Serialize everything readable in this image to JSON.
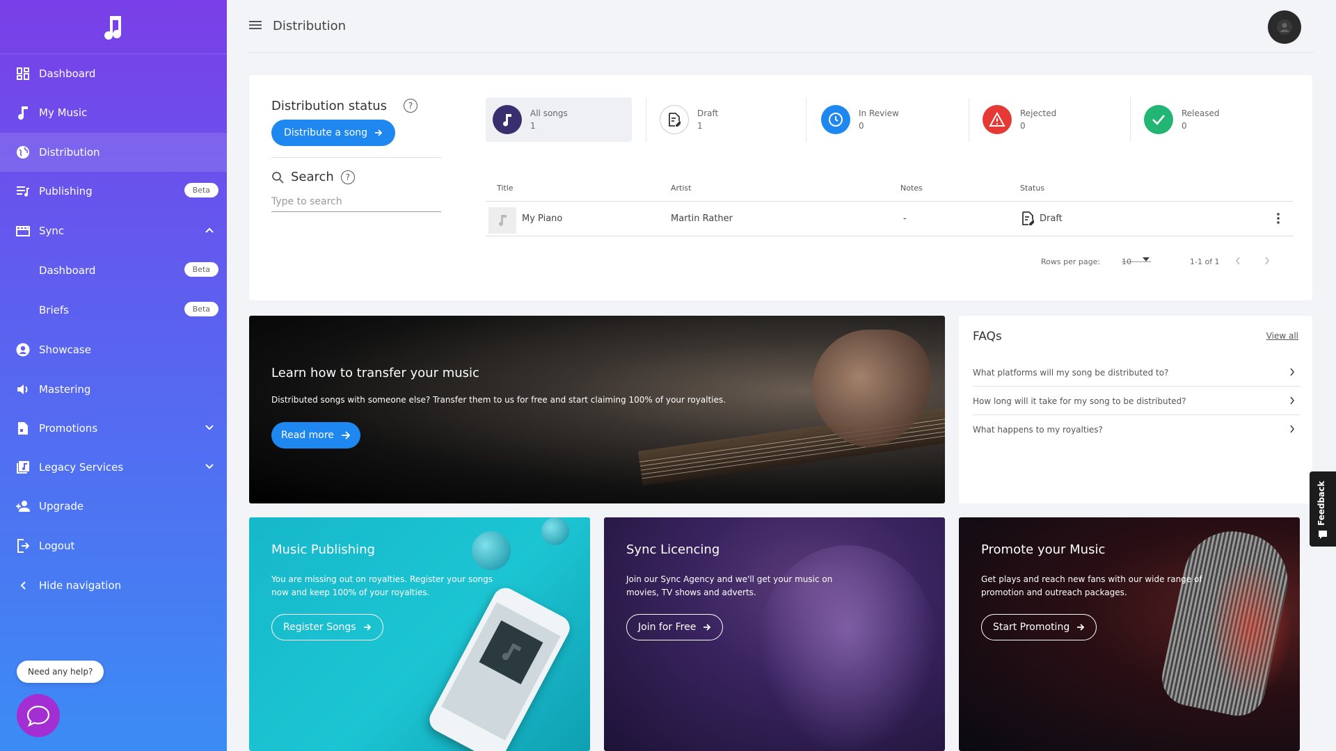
{
  "page": {
    "title": "Distribution"
  },
  "sidebar": {
    "items": [
      {
        "label": "Dashboard",
        "icon": "dashboard-icon"
      },
      {
        "label": "My Music",
        "icon": "music-note-icon"
      },
      {
        "label": "Distribution",
        "icon": "globe-icon",
        "active": true
      },
      {
        "label": "Publishing",
        "icon": "playlist-icon",
        "badge": "Beta"
      },
      {
        "label": "Sync",
        "icon": "clapperboard-icon",
        "expanded": true
      },
      {
        "label": "Dashboard",
        "sub": true,
        "badge": "Beta"
      },
      {
        "label": "Briefs",
        "sub": true,
        "badge": "Beta"
      },
      {
        "label": "Showcase",
        "icon": "account-circle-icon"
      },
      {
        "label": "Mastering",
        "icon": "speaker-icon"
      },
      {
        "label": "Promotions",
        "icon": "document-icon",
        "collapsed": true
      },
      {
        "label": "Legacy Services",
        "icon": "library-icon",
        "collapsed": true
      },
      {
        "label": "Upgrade",
        "icon": "user-plus-icon"
      },
      {
        "label": "Logout",
        "icon": "logout-icon"
      },
      {
        "label": "Hide navigation",
        "icon": "chevron-left-icon"
      }
    ],
    "help_label": "Need any help?"
  },
  "status": {
    "title": "Distribution status",
    "distribute_label": "Distribute a song",
    "search_label": "Search",
    "search_placeholder": "Type to search",
    "cards": [
      {
        "name": "All songs",
        "count": "1",
        "color": "#3a2f6e"
      },
      {
        "name": "Draft",
        "count": "1",
        "color": "#ffffff"
      },
      {
        "name": "In Review",
        "count": "0",
        "color": "#1e88f0"
      },
      {
        "name": "Rejected",
        "count": "0",
        "color": "#e53935"
      },
      {
        "name": "Released",
        "count": "0",
        "color": "#22b573"
      }
    ],
    "table": {
      "headers": [
        "Title",
        "Artist",
        "Notes",
        "Status"
      ],
      "rows": [
        {
          "title": "My Piano",
          "artist": "Martin Rather",
          "notes": "-",
          "status": "Draft"
        }
      ]
    },
    "pager": {
      "rows_label": "Rows per page:",
      "rows_value": "10",
      "range": "1-1 of 1"
    }
  },
  "banner": {
    "title": "Learn how to transfer your music",
    "text": "Distributed songs with someone else? Transfer them to us for free and start claiming 100% of your royalties.",
    "button": "Read more"
  },
  "faqs": {
    "title": "FAQs",
    "view_all": "View all",
    "items": [
      "What platforms will my song be distributed to?",
      "How long will it take for my song to be distributed?",
      "What happens to my royalties?"
    ]
  },
  "cards": {
    "publishing": {
      "title": "Music Publishing",
      "text": "You are missing out on royalties. Register your songs now and keep 100% of your royalties.",
      "button": "Register Songs"
    },
    "sync": {
      "title": "Sync Licencing",
      "text": "Join our Sync Agency and we'll get your music on movies, TV shows and adverts.",
      "button": "Join for Free"
    },
    "promote": {
      "title": "Promote your Music",
      "text": "Get plays and reach new fans with our wide range of promotion and outreach packages.",
      "button": "Start Promoting"
    }
  },
  "feedback": {
    "label": "Feedback"
  }
}
